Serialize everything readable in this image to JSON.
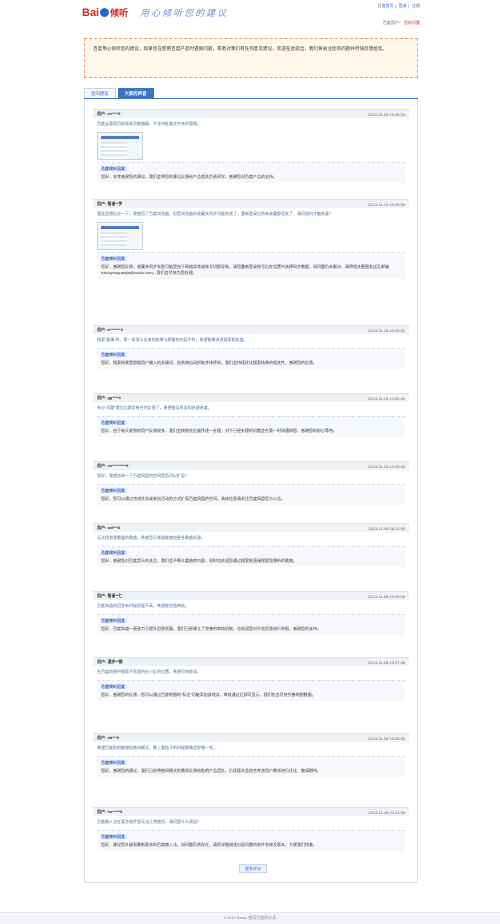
{
  "header": {
    "logo_bai": "Bai",
    "logo_name": "倾听",
    "slogan": "用心倾听您的建议",
    "links": [
      "百度首页",
      "登录",
      "注册"
    ],
    "user_prefix": "百度用户：",
    "user_link": "您的问题"
  },
  "notice": {
    "text": "百度用心倾听您的建议，如果您在使用百度产品时遇到问题，或者对我们有任何意见建议，欢迎在此提出，我们将关注您的问题并尽快反馈给您。"
  },
  "tabs": [
    {
      "label": "您的建议"
    },
    {
      "label": "大家的声音"
    }
  ],
  "answer_label": "百度倾听回复：",
  "items": [
    {
      "name": "用户: zh****5",
      "time": "2013-12-05 15:48:34",
      "question": "百度云管家目前版本功能偏弱，不支持批量文件夹的管理。",
      "has_shot": true,
      "answer": "您好，非常感谢您的建议，我们会将您的意见反馈给产品相关负责同学，感谢您对百度产品的支持。"
    },
    {
      "name": "用户: 智者**罗",
      "time": "2013-11-20 16:05:59",
      "question": "我这里想反应一下，我使用了百度浏览器，但是浏览器的收藏夹同步功能失效了，重新登录后所有收藏都丢失了，请问如何才能恢复？",
      "has_shot": true,
      "answer": "您好，感谢您反馈，收藏夹同步失败可能是由于网络异常或账号切换导致，请您重新登录账号后在设置中选择同步数据，如问题仍未解决，请将相关截图发送至邮箱 baiduyunguanjia@baidu.com，我们会尽快为您处理。"
    },
    {
      "name": "用户: k*******3",
      "time": "2013-11-15 10:06:51",
      "question": "搜索“要事”时，第一条显示出来的结果与想要的内容不符，希望能够改进搜索相关度。",
      "has_shot": false,
      "answer": "您好，搜索结果是根据用户输入的关键词，由系统自动抓取并排序的，我们会持续优化搜索结果的相关性，感谢您的反馈。"
    },
    {
      "name": "用户: gg****4",
      "time": "2013-11-15 14:52:49",
      "question": "有过“问题”提交后就没有任何反馈了，希望能及时告知处理进度。",
      "has_shot": false,
      "answer": "您好，由于每天收到的用户反馈较多，我们会按照先后顺序逐一处理，对于已经处理的问题会在第一时间通知您，感谢您的耐心等待。"
    },
    {
      "name": "用户: ch*********9",
      "time": "2013-11-15 14:45:40",
      "question": "您好，我想咨询一下百度网盘的空间是否可以扩容？",
      "has_shot": false,
      "answer": "您好，您可以通过完成任务或参加活动的方式扩容百度网盘的空间，具体信息请关注百度网盘官方公告。"
    },
    {
      "name": "用户: wd***8",
      "time": "2013-11-08 16:11:55",
      "question": "无法找到我需要的歌曲，希望音乐频道能增加更多歌曲资源。",
      "has_shot": false,
      "answer": "您好，感谢您对百度音乐的关注，我们会不断丰富曲库内容，同时也欢迎您通过搜索框直接搜索您想听的歌曲。"
    },
    {
      "name": "用户: 智者**仁",
      "time": "2013-11-08 10:59:00",
      "question": "百度知道的回答有时候质量不高，希望能加强审核。",
      "has_shot": false,
      "answer": "您好，百度知道一直致力于提升回答质量，我们已经建立了完善的审核机制，也欢迎您对不良回答进行举报，感谢您的支持。"
    },
    {
      "name": "用户: 漫步**钢",
      "time": "2013-11-08 15:27:46",
      "question": "在百度地图中搜索不到我所在小区的位置，希望尽快收录。",
      "has_shot": false,
      "answer": "您好，感谢您的反馈，您可以通过百度地图的“标注”功能添加该地点，审核通过后即可显示，我们也会尽快完善地图数据。"
    },
    {
      "name": "用户: dd***9",
      "time": "2013-11-08 10:36:30",
      "question": "希望百度贴吧能增加夜间模式，晚上看帖子的时候眼睛会舒服一些。",
      "has_shot": false,
      "answer": "您好，感谢您的建议，我们已经将夜间模式的需求反馈给贴吧产品团队，后续版本会综合考虑用户需求进行优化，敬请期待。"
    },
    {
      "name": "用户: ho*****5",
      "time": "2013-11-08 14:11:55",
      "question": "百度输入法在某些软件里无法正常使用，请问是什么原因？",
      "has_shot": false,
      "answer": "您好，建议您升级到最新版本的百度输入法，如问题仍然存在，请您详细描述出现问题的软件名称及版本，方便我们排查。"
    }
  ],
  "more_label": "更多评论",
  "footer": "©2013 Baidu 使用百度前必读"
}
